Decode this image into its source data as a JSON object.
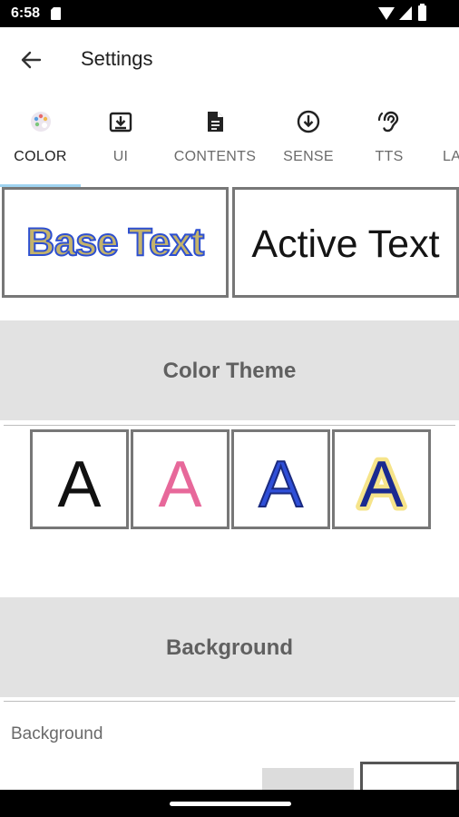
{
  "status_bar": {
    "time": "6:58"
  },
  "app_bar": {
    "title": "Settings"
  },
  "tabs": [
    {
      "label": "COLOR",
      "icon": "palette-icon",
      "active": true
    },
    {
      "label": "UI",
      "icon": "download-box-icon"
    },
    {
      "label": "CONTENTS",
      "icon": "document-icon"
    },
    {
      "label": "SENSE",
      "icon": "arrow-circle-down-icon"
    },
    {
      "label": "TTS",
      "icon": "hearing-icon"
    },
    {
      "label": "LA",
      "icon": ""
    }
  ],
  "preview": {
    "base_text": "Base Text",
    "active_text": "Active Text"
  },
  "sections": {
    "color_theme": "Color Theme",
    "background": "Background"
  },
  "themes": [
    {
      "letter": "A",
      "fill": "#111111",
      "stroke": "#111111",
      "glow": ""
    },
    {
      "letter": "A",
      "fill": "#e7689a",
      "stroke": "#e7689a",
      "glow": ""
    },
    {
      "letter": "A",
      "fill": "#2f4fd8",
      "stroke": "#1a2a80",
      "glow": ""
    },
    {
      "letter": "A",
      "fill": "#1a2a90",
      "stroke": "#1a2a90",
      "glow": "#f6e48a"
    }
  ],
  "background_setting": {
    "label": "Background"
  },
  "colors": {
    "base_text_fill": "#c4b36b",
    "base_text_outline": "#2d4fd0",
    "section_header_bg": "#e2e2e2",
    "tab_indicator": "#9fd3f0"
  }
}
